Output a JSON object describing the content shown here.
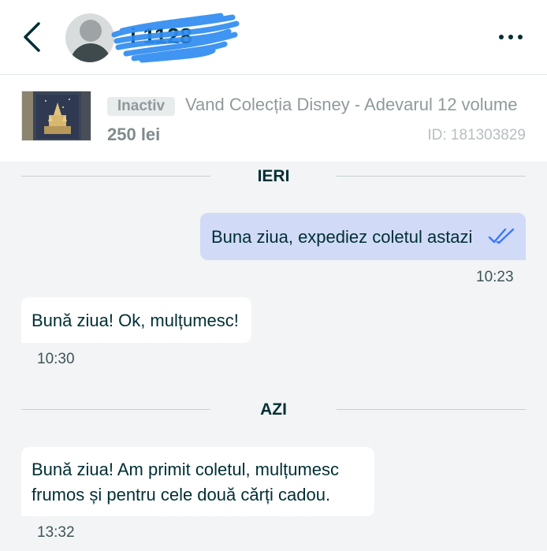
{
  "header": {
    "username": "i 1128",
    "colors": {
      "background": "#ffffff",
      "text": "#002f34"
    }
  },
  "listing": {
    "status_badge": "Inactiv",
    "title": "Vand Colecția Disney - Adevarul 12 volume",
    "price": "250 lei",
    "id_text": "ID: 181303829"
  },
  "chat": {
    "days": [
      {
        "label": "IERI"
      },
      {
        "label": "AZI"
      }
    ],
    "messages": [
      {
        "direction": "outgoing",
        "text": "Buna ziua, expediez coletul astazi",
        "time": "10:23",
        "status": "read"
      },
      {
        "direction": "incoming",
        "text": "Bună ziua! Ok, mulțumesc!",
        "time": "10:30"
      },
      {
        "direction": "incoming",
        "text": "Bună ziua! Am primit coletul, mulțumesc frumos și pentru cele două cărți cadou.",
        "time": "13:32"
      }
    ],
    "colors": {
      "outgoing_bubble": "#d1daf7",
      "incoming_bubble": "#ffffff",
      "background": "#f2f4f5",
      "read_check": "#3a77ff"
    }
  },
  "icons": {
    "back": "chevron-left-icon",
    "menu": "more-horizontal-icon",
    "read_receipt": "double-check-icon"
  }
}
